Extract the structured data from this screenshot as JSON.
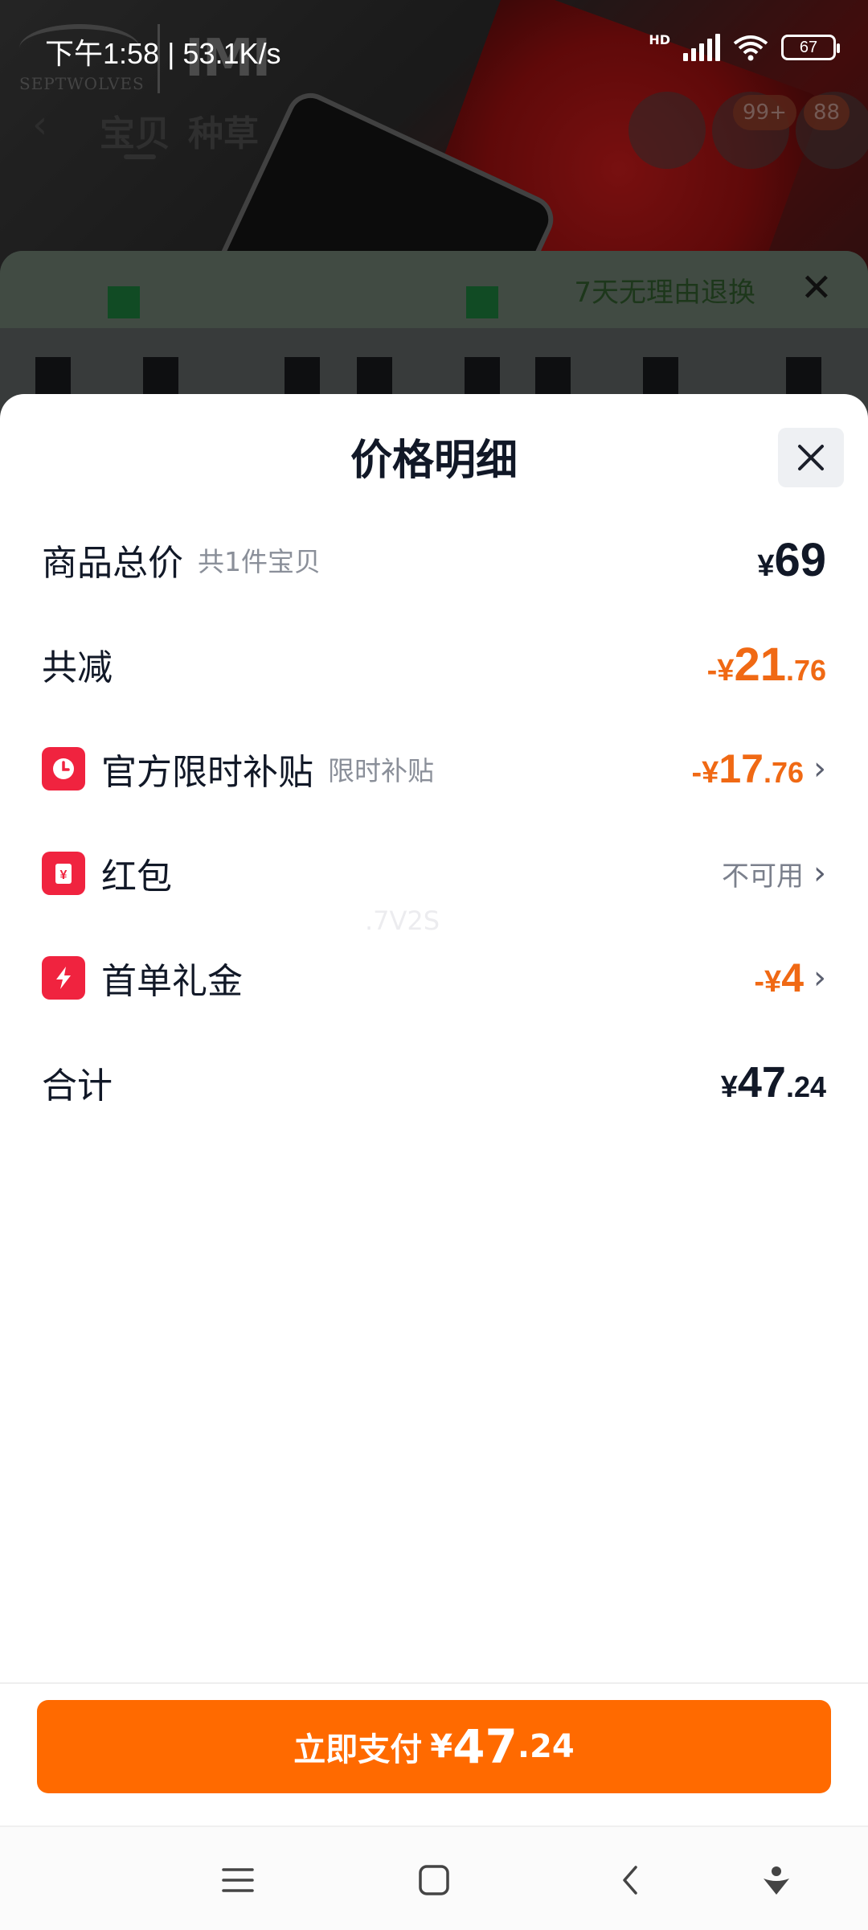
{
  "status_bar": {
    "time": "下午1:58 | 53.1K/s",
    "network_label": "HD",
    "battery": "67"
  },
  "background_page": {
    "brand_logo_text": "SEPTWOLVES",
    "brand_mark_text": "IMI",
    "tabs": [
      "宝贝",
      "种草"
    ],
    "cart_badge": "99+",
    "more_badge": "88",
    "banner_text": "7天无理由退换"
  },
  "sheet": {
    "title": "价格明细",
    "rows": {
      "total": {
        "label": "商品总价",
        "sub": "共1件宝贝",
        "yen": "¥",
        "amount": "69",
        "decimals": ""
      },
      "reduction": {
        "label": "共减",
        "sign": "-¥",
        "amount": "21",
        "decimals": ".76"
      },
      "subsidy": {
        "label": "官方限时补贴",
        "sub": "限时补贴",
        "sign": "-¥",
        "amount": "17",
        "decimals": ".76",
        "icon": "clock-icon"
      },
      "red_packet": {
        "label": "红包",
        "status": "不可用",
        "icon": "red-packet-icon"
      },
      "first_order": {
        "label": "首单礼金",
        "sign": "-¥",
        "amount": "4",
        "icon": "lightning-icon"
      },
      "sum": {
        "label": "合计",
        "yen": "¥",
        "amount": "47",
        "decimals": ".24"
      }
    },
    "watermark": ".7V2S"
  },
  "pay_button": {
    "label": "立即支付",
    "yen": "¥",
    "amount": "47",
    "decimals": ".24"
  },
  "colors": {
    "accent": "#ff6a00",
    "discount": "#f06914",
    "icon_red": "#f0233f"
  }
}
